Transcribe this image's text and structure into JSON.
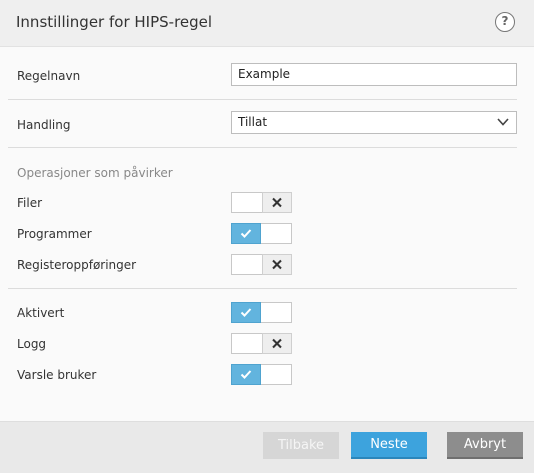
{
  "dialog": {
    "title": "Innstillinger for HIPS-regel",
    "help_label": "?"
  },
  "rule_name": {
    "label": "Regelnavn",
    "value": "Example"
  },
  "action": {
    "label": "Handling",
    "selected": "Tillat"
  },
  "operations": {
    "section_label": "Operasjoner som påvirker",
    "items": [
      {
        "label": "Filer",
        "enabled": false
      },
      {
        "label": "Programmer",
        "enabled": true
      },
      {
        "label": "Registeroppføringer",
        "enabled": false
      }
    ]
  },
  "options": {
    "items": [
      {
        "label": "Aktivert",
        "enabled": true
      },
      {
        "label": "Logg",
        "enabled": false
      },
      {
        "label": "Varsle bruker",
        "enabled": true
      }
    ]
  },
  "footer": {
    "back_label": "Tilbake",
    "next_label": "Neste",
    "cancel_label": "Avbryt"
  },
  "colors": {
    "accent": "#3da3dd",
    "toggle_on": "#62b4de"
  }
}
